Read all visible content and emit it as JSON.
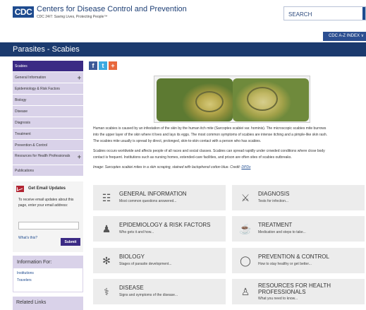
{
  "header": {
    "logo_text": "CDC",
    "site_title": "Centers for Disease Control and Prevention",
    "tagline": "CDC 24/7: Saving Lives, Protecting People™",
    "search_placeholder": "SEARCH",
    "atoz_label": "CDC A-Z INDEX ∨"
  },
  "banner": {
    "title": "Parasites - Scabies"
  },
  "sidebar": {
    "items": [
      {
        "label": "Scabies",
        "active": true
      },
      {
        "label": "General Information",
        "expandable": true
      },
      {
        "label": "Epidemiology & Risk Factors"
      },
      {
        "label": "Biology"
      },
      {
        "label": "Disease"
      },
      {
        "label": "Diagnosis"
      },
      {
        "label": "Treatment"
      },
      {
        "label": "Prevention & Control"
      },
      {
        "label": "Resources for Health Professionals",
        "expandable": true
      },
      {
        "label": "Publications"
      }
    ]
  },
  "email_updates": {
    "title": "Get Email Updates",
    "text": "To receive email updates about this page, enter your email address:",
    "input_value": "",
    "whats_this": "What's this?",
    "submit_label": "Submit"
  },
  "info_for": {
    "title": "Information For:",
    "links": [
      "Institutions",
      "Travelers"
    ]
  },
  "related_links": {
    "title": "Related Links"
  },
  "share": {
    "facebook": "f",
    "twitter": "t",
    "more": "+"
  },
  "content": {
    "para1_line1": "Human scabies is caused by an infestation of the skin by the human itch mite (Sarcoptes scabiei var. hominis). The microscopic scabies mite burrows",
    "para1_line2": "into the upper layer of the skin where it lives and lays its eggs. The most common symptoms of scabies are intense itching and a pimple-like skin rash.",
    "para1_line3": "The scabies mite usually is spread by direct, prolonged, skin-to-skin contact with a person who has scabies.",
    "para2_line1": "Scabies occurs worldwide and affects people of all races and social classes. Scabies can spread rapidly under crowded conditions where close body",
    "para2_line2": "contact is frequent. Institutions such as nursing homes, extended-care facilities, and prison are often sites of scabies outbreaks.",
    "caption_text": "Image: Sarcoptes scabiei mites in a skin scraping, stained with lactophenol cotton blue. Credit: ",
    "caption_link": "DPDx"
  },
  "tiles": [
    {
      "title": "GENERAL INFORMATION",
      "sub": "Most common questions answered...",
      "icon": "clipboard-icon"
    },
    {
      "title": "DIAGNOSIS",
      "sub": "Tests for infection...",
      "icon": "microscope-icon"
    },
    {
      "title": "EPIDEMIOLOGY & RISK FACTORS",
      "sub": "Who gets it and how...",
      "icon": "people-icon"
    },
    {
      "title": "TREATMENT",
      "sub": "Medication and steps to take...",
      "icon": "mortar-pestle-icon"
    },
    {
      "title": "BIOLOGY",
      "sub": "Stages of parasite development...",
      "icon": "biology-icon"
    },
    {
      "title": "PREVENTION & CONTROL",
      "sub": "How to stay healthy or get better...",
      "icon": "prevention-icon"
    },
    {
      "title": "DISEASE",
      "sub": "Signs and symptoms of the disease...",
      "icon": "stethoscope-icon"
    },
    {
      "title": "RESOURCES FOR HEALTH PROFESSIONALS",
      "sub": "What you need to know...",
      "icon": "professionals-icon"
    }
  ],
  "colors": {
    "brand_blue": "#1e4b8f",
    "banner": "#1b3a6e",
    "nav_active": "#3b2a84",
    "nav_bg": "#d9d2e9"
  }
}
